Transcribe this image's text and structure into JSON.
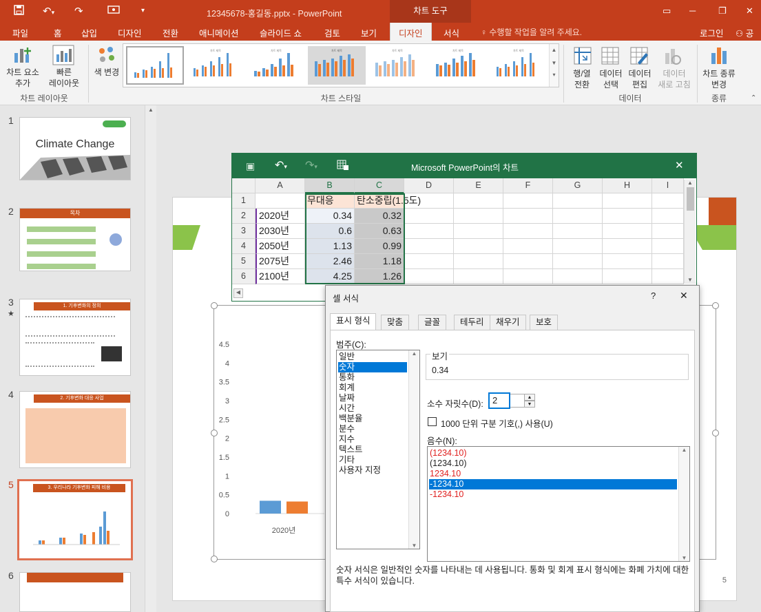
{
  "window": {
    "title": "12345678-홍길동.pptx - PowerPoint",
    "contextual_tab_group": "차트 도구"
  },
  "tabs": [
    "파일",
    "홈",
    "삽입",
    "디자인",
    "전환",
    "애니메이션",
    "슬라이드 쇼",
    "검토",
    "보기",
    "디자인",
    "서식"
  ],
  "active_tab_index": 9,
  "tell_me": "수행할 작업을 알려 주세요.",
  "sign_in": "로그인",
  "share": "공유",
  "ribbon": {
    "add_element": "차트 요소\n추가",
    "quick_layout": "빠른\n레이아웃",
    "group_chart_layout": "차트 레이아웃",
    "change_color": "색 변경",
    "group_chart_styles": "차트 스타일",
    "switch_row_col": "행/열\n전환",
    "select_data": "데이터\n선택",
    "edit_data": "데이터\n편집",
    "refresh_data": "데이터\n새로 고침",
    "group_data": "데이터",
    "change_chart_type": "차트 종류\n변경",
    "group_type": "종류"
  },
  "slides": [
    {
      "num": "1",
      "title": "Climate Change"
    },
    {
      "num": "2",
      "title": "목차"
    },
    {
      "num": "3",
      "title": "1. 기후변화의 정의"
    },
    {
      "num": "4",
      "title": "2. 기후변화 대응 사업"
    },
    {
      "num": "5",
      "title": "3. 우리나라 기후변화 피해 비용"
    },
    {
      "num": "6",
      "title": ""
    }
  ],
  "current_slide": 5,
  "excel": {
    "title": "Microsoft PowerPoint의 차트",
    "columns": [
      "A",
      "B",
      "C",
      "D",
      "E",
      "F",
      "G",
      "H",
      "I"
    ],
    "rows": [
      {
        "n": "1",
        "a": "",
        "b": "무대응",
        "c": "탄소중립(1.5도)"
      },
      {
        "n": "2",
        "a": "2020년",
        "b": "0.34",
        "c": "0.32"
      },
      {
        "n": "3",
        "a": "2030년",
        "b": "0.6",
        "c": "0.63"
      },
      {
        "n": "4",
        "a": "2050년",
        "b": "1.13",
        "c": "0.99"
      },
      {
        "n": "5",
        "a": "2075년",
        "b": "2.46",
        "c": "1.18"
      },
      {
        "n": "6",
        "a": "2100년",
        "b": "4.25",
        "c": "1.26"
      }
    ]
  },
  "chart_data": {
    "type": "bar",
    "categories": [
      "2020년"
    ],
    "series": [
      {
        "values": [
          0.34
        ],
        "color": "#5b9bd5"
      },
      {
        "values": [
          0.32
        ],
        "color": "#ed7d31"
      }
    ],
    "yticks": [
      "4.5",
      "4",
      "3.5",
      "3",
      "2.5",
      "2",
      "1.5",
      "1",
      "0.5",
      "0"
    ],
    "ylim": [
      0,
      4.5
    ]
  },
  "page_number": "5",
  "dialog": {
    "title": "셀 서식",
    "help": "?",
    "close": "✕",
    "tabs": [
      "표시 형식",
      "맞춤",
      "글꼴",
      "테두리",
      "채우기",
      "보호"
    ],
    "category_label": "범주(C):",
    "categories": [
      "일반",
      "숫자",
      "통화",
      "회계",
      "날짜",
      "시간",
      "백분율",
      "분수",
      "지수",
      "텍스트",
      "기타",
      "사용자 지정"
    ],
    "selected_category": 1,
    "sample_label": "보기",
    "sample_value": "0.34",
    "decimal_label": "소수 자릿수(D):",
    "decimal_value": "2",
    "thousands_label": "1000 단위 구분 기호(,) 사용(U)",
    "negative_label": "음수(N):",
    "negative_options": [
      "(1234.10)",
      "(1234.10)",
      "1234.10",
      "-1234.10",
      "-1234.10"
    ],
    "negative_red": [
      true,
      false,
      true,
      false,
      true
    ],
    "negative_selected": 3,
    "description": "숫자 서식은 일반적인 숫자를 나타내는 데 사용됩니다. 통화 및 회계 표시 형식에는 화폐 가치에 대한 특수 서식이 있습니다."
  }
}
